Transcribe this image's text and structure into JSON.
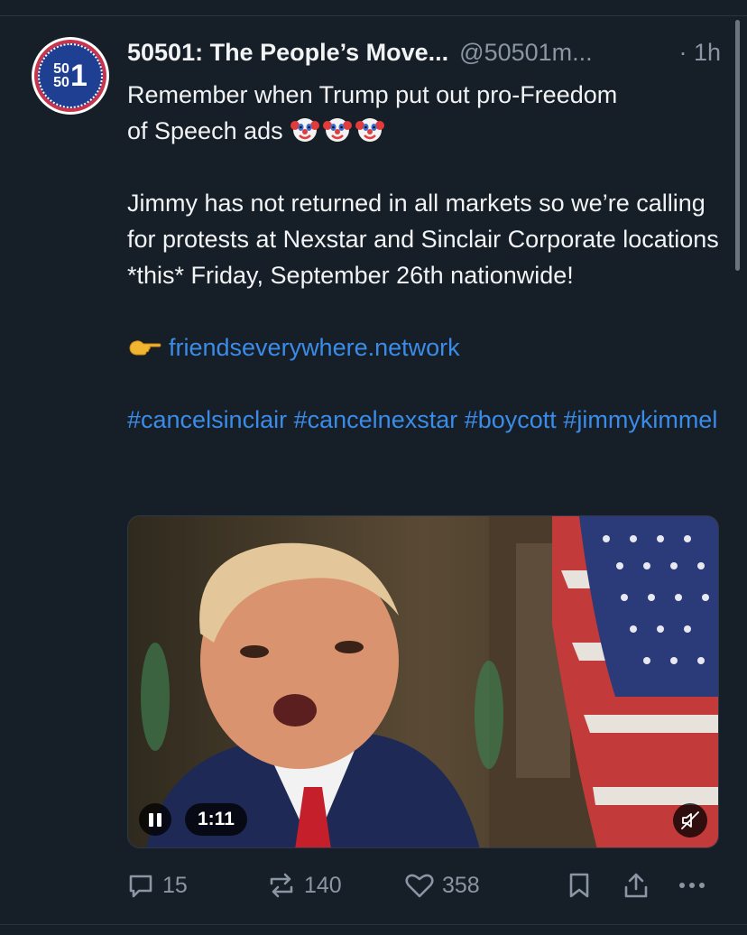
{
  "post": {
    "author_name": "50501: The People’s Move...",
    "author_handle": "@50501m...",
    "time": "· 1h",
    "avatar": {
      "small_top": "50",
      "small_bottom": "50",
      "big": "1"
    },
    "line1": "Remember when Trump put out pro-Freedom",
    "line2": "of Speech ads",
    "emoji": [
      "clown-face",
      "clown-face",
      "clown-face"
    ],
    "paragraph2": "Jimmy has not returned in all markets so we’re calling for protests at Nexstar and Sinclair Corporate locations *this* Friday, September 26th nationwide!",
    "link_icon": "backhand-index-pointing-left",
    "link": "friendseverywhere.network",
    "hashtags": [
      "#cancelsinclair",
      "#cancelnexstar",
      "#boycott",
      "#jimmykimmel"
    ]
  },
  "video": {
    "duration": "1:11",
    "state": "playing",
    "muted": true
  },
  "actions": {
    "replies": "15",
    "reposts": "140",
    "likes": "358"
  },
  "colors": {
    "background": "#161e27",
    "text": "#f1f3f5",
    "muted": "#8a96a3",
    "link": "#3a8ce8"
  }
}
